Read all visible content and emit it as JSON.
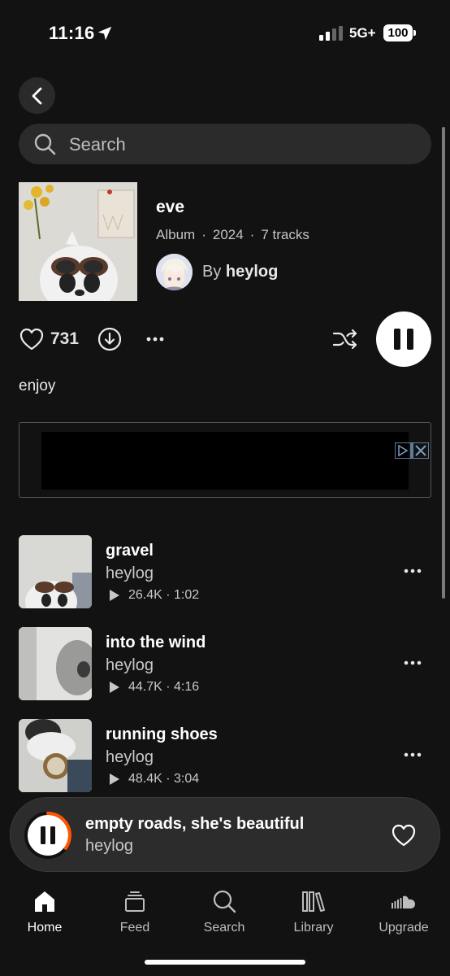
{
  "status_bar": {
    "time": "11:16",
    "network": "5G+",
    "battery": "100"
  },
  "search": {
    "placeholder": "Search"
  },
  "album": {
    "title": "eve",
    "type": "Album",
    "year": "2024",
    "track_count": "7 tracks",
    "by_prefix": "By",
    "artist": "heylog",
    "likes": "731",
    "description": "enjoy"
  },
  "tracks": [
    {
      "title": "gravel",
      "artist": "heylog",
      "plays": "26.4K",
      "duration": "1:02"
    },
    {
      "title": "into the wind",
      "artist": "heylog",
      "plays": "44.7K",
      "duration": "4:16"
    },
    {
      "title": "running shoes",
      "artist": "heylog",
      "plays": "48.4K",
      "duration": "3:04"
    }
  ],
  "now_playing": {
    "title": "empty roads, she's beautiful",
    "artist": "heylog",
    "progress": 0.35
  },
  "tabs": [
    {
      "label": "Home",
      "icon": "home-icon",
      "active": true
    },
    {
      "label": "Feed",
      "icon": "feed-icon"
    },
    {
      "label": "Search",
      "icon": "search-icon"
    },
    {
      "label": "Library",
      "icon": "library-icon"
    },
    {
      "label": "Upgrade",
      "icon": "soundcloud-icon"
    }
  ],
  "colors": {
    "background": "#121212",
    "accent": "#ff5500",
    "surface": "#2b2b2b"
  }
}
